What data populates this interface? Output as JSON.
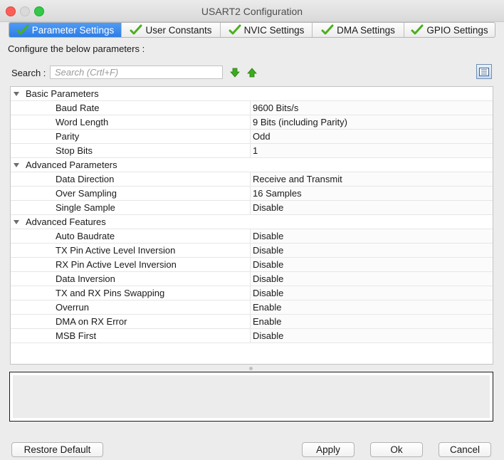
{
  "window": {
    "title": "USART2 Configuration"
  },
  "tabs": [
    {
      "label": "Parameter Settings",
      "active": true
    },
    {
      "label": "User Constants",
      "active": false
    },
    {
      "label": "NVIC Settings",
      "active": false
    },
    {
      "label": "DMA Settings",
      "active": false
    },
    {
      "label": "GPIO Settings",
      "active": false
    }
  ],
  "configure_label": "Configure the below parameters :",
  "search": {
    "label": "Search :",
    "placeholder": "Search (Crtl+F)"
  },
  "groups": [
    {
      "name": "Basic Parameters",
      "params": [
        {
          "name": "Baud Rate",
          "value": "9600 Bits/s"
        },
        {
          "name": "Word Length",
          "value": "9 Bits (including Parity)"
        },
        {
          "name": "Parity",
          "value": "Odd"
        },
        {
          "name": "Stop Bits",
          "value": "1"
        }
      ]
    },
    {
      "name": "Advanced Parameters",
      "params": [
        {
          "name": "Data Direction",
          "value": "Receive and Transmit"
        },
        {
          "name": "Over Sampling",
          "value": "16 Samples"
        },
        {
          "name": "Single Sample",
          "value": "Disable"
        }
      ]
    },
    {
      "name": "Advanced Features",
      "params": [
        {
          "name": "Auto Baudrate",
          "value": "Disable"
        },
        {
          "name": "TX Pin Active Level Inversion",
          "value": "Disable"
        },
        {
          "name": "RX Pin Active Level Inversion",
          "value": "Disable"
        },
        {
          "name": "Data Inversion",
          "value": "Disable"
        },
        {
          "name": "TX and RX Pins Swapping",
          "value": "Disable"
        },
        {
          "name": "Overrun",
          "value": "Enable"
        },
        {
          "name": "DMA on RX Error",
          "value": "Enable"
        },
        {
          "name": "MSB First",
          "value": "Disable"
        }
      ]
    }
  ],
  "buttons": {
    "restore_default": "Restore Default",
    "apply": "Apply",
    "ok": "Ok",
    "cancel": "Cancel"
  },
  "colors": {
    "active_tab": "#2e7de6",
    "check_green": "#4caf1e",
    "arrow_green": "#3cab1c"
  }
}
